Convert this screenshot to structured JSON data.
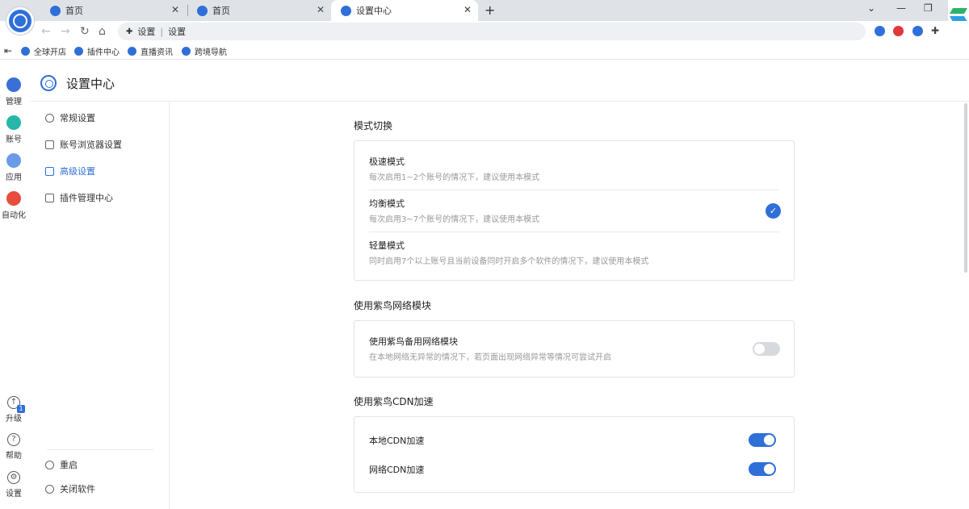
{
  "browser": {
    "tabs": [
      {
        "title": "首页",
        "active": false
      },
      {
        "title": "首页",
        "active": false
      },
      {
        "title": "设置中心",
        "active": true
      }
    ],
    "new_tab_label": "+",
    "address": {
      "prefix": "设置",
      "value": "设置"
    },
    "bookmarks": [
      "全球开店",
      "插件中心",
      "直播资讯",
      "跨境导航"
    ]
  },
  "rail": {
    "items": [
      {
        "label": "管理",
        "icon": "grid-icon",
        "color": "#3a6fd8"
      },
      {
        "label": "账号",
        "icon": "account-icon",
        "color": "#27b6a7"
      },
      {
        "label": "应用",
        "icon": "apps-icon",
        "color": "#6a9ae8"
      },
      {
        "label": "自动化",
        "icon": "robot-icon",
        "color": "#e84c3d"
      }
    ],
    "bottom": [
      {
        "label": "升级",
        "icon": "upgrade-icon",
        "badge": "1"
      },
      {
        "label": "帮助",
        "icon": "help-icon"
      },
      {
        "label": "设置",
        "icon": "settings-icon"
      }
    ]
  },
  "settings": {
    "title": "设置中心",
    "menu": [
      {
        "label": "常规设置",
        "active": false
      },
      {
        "label": "账号浏览器设置",
        "active": false
      },
      {
        "label": "高级设置",
        "active": true
      },
      {
        "label": "插件管理中心",
        "active": false
      }
    ],
    "footer": {
      "restart": "重启",
      "quit": "关闭软件"
    }
  },
  "content": {
    "mode_section": {
      "title": "模式切换",
      "modes": [
        {
          "name": "极速模式",
          "desc": "每次启用1~2个账号的情况下，建议使用本模式",
          "selected": false
        },
        {
          "name": "均衡模式",
          "desc": "每次启用3~7个账号的情况下，建议使用本模式",
          "selected": true
        },
        {
          "name": "轻量模式",
          "desc": "同时启用7个以上账号且当前设备同时开启多个软件的情况下，建议使用本模式",
          "selected": false
        }
      ],
      "check_glyph": "✓"
    },
    "network_section": {
      "title": "使用紫鸟网络模块",
      "option": {
        "name": "使用紫鸟备用网络模块",
        "desc": "在本地网络无异常的情况下，若页面出现网络异常等情况可尝试开启",
        "enabled": false
      }
    },
    "cdn_section": {
      "title": "使用紫鸟CDN加速",
      "options": [
        {
          "name": "本地CDN加速",
          "enabled": true
        },
        {
          "name": "网络CDN加速",
          "enabled": true
        }
      ]
    }
  },
  "colors": {
    "accent": "#2f6fd8",
    "toggle_off": "#d6d9de"
  }
}
